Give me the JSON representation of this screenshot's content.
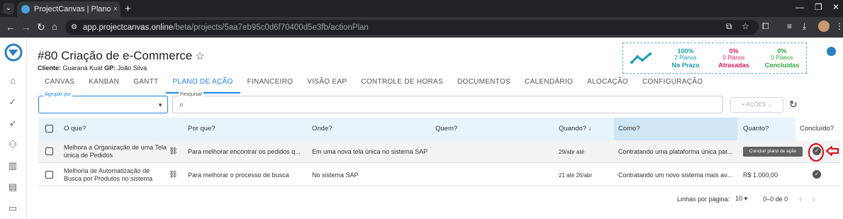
{
  "browser": {
    "tab_title": "ProjectCanvas | Plano de Ação",
    "tab_close": "×",
    "new_tab": "+",
    "url_host": "app.projectcanvas.online",
    "url_path": "/beta/projects/5aa7eb95c0d6f70400d5e3fb/actionPlan"
  },
  "project": {
    "title": "#80 Criação de e-Commerce",
    "client_label": "Cliente:",
    "client_value": "Guaraná Kuat",
    "gp_label": "GP:",
    "gp_value": "João Silva"
  },
  "stats": [
    {
      "pct": "100%",
      "count": "2 Planos",
      "label": "No Prazo",
      "color": "#1a9fb0"
    },
    {
      "pct": "0%",
      "count": "0 Planos",
      "label": "Atrasadas",
      "color": "#d81b60"
    },
    {
      "pct": "0%",
      "count": "0 Planos",
      "label": "Concluídas",
      "color": "#2eaa3c"
    }
  ],
  "tabs": [
    "CANVAS",
    "KANBAN",
    "GANTT",
    "PLANO DE AÇÃO",
    "FINANCEIRO",
    "VISÃO EAP",
    "CONTROLE DE HORAS",
    "DOCUMENTOS",
    "CALENDÁRIO",
    "ALOCAÇÃO",
    "CONFIGURAÇÃO"
  ],
  "active_tab": "PLANO DE AÇÃO",
  "filters": {
    "group_by_label": "Agrupar por",
    "search_label": "Pesquisar",
    "actions_label": "+ AÇÕES ⌄"
  },
  "table": {
    "headers": [
      "O que?",
      "Por que?",
      "Onde?",
      "Quem?",
      "Quando? ↓",
      "Como?",
      "Quanto?",
      "Concluído?"
    ],
    "rows": [
      {
        "what": "Melhora a Organização de uma Tela única de Pedidos",
        "why": "Para melhorar encontrar os pedidos q...",
        "where": "Em uma nova tela única no sistema SAP",
        "who": "",
        "when": "29/abr até",
        "how": "Contratando uma plataforma única par...",
        "howmuch": ""
      },
      {
        "what": "Melhoria de Automatização de Busca por Produtos no sistema",
        "why": "Para melhorar o processo de busca",
        "where": "No sistema SAP",
        "who": "",
        "when": "21 até 26/abr",
        "how": "Contratando um novo sistema mais av...",
        "howmuch": "R$ 1.000,00"
      }
    ],
    "tooltip": "Concluir plano de ação"
  },
  "pagination": {
    "rows_per_page_label": "Linhas por página:",
    "rows_per_page_value": "10 ▾",
    "range": "0–0 de 0",
    "prev": "‹",
    "next": "›"
  }
}
